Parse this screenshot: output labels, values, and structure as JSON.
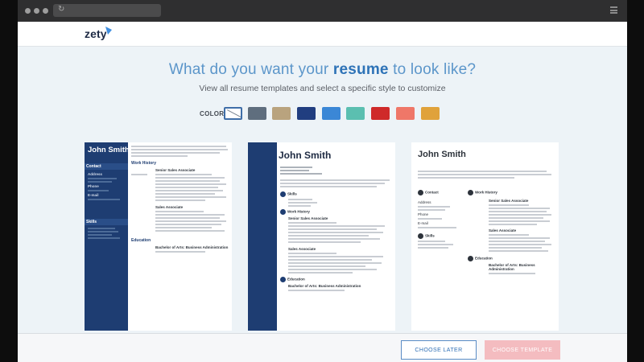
{
  "header": {
    "logo": "zety"
  },
  "hero": {
    "headline_pre": "What do you want your ",
    "headline_emph": "resume",
    "headline_post": " to look like?",
    "subline": "View all resume templates and select a specific style to customize"
  },
  "colors": {
    "label": "COLOR",
    "swatches": [
      "#ffffff",
      "#5f6e7e",
      "#b9a37e",
      "#213e80",
      "#3b87d6",
      "#5bbfb0",
      "#cf2a2a",
      "#ef7768",
      "#e0a23b"
    ],
    "selected_index": 0
  },
  "templates": [
    {
      "name": "John Smith",
      "sections": [
        "Contact",
        "Skills",
        "Work History",
        "Education"
      ],
      "contact_labels": [
        "Address",
        "Phone",
        "E-mail"
      ],
      "jobs": [
        "Senior Sales Associate",
        "Sales Associate"
      ],
      "degree": "Bachelor of Arts: Business Administration"
    },
    {
      "name": "John Smith",
      "sections": [
        "Skills",
        "Work History",
        "Education"
      ],
      "jobs": [
        "Senior Sales Associate",
        "Sales Associate"
      ],
      "degree": "Bachelor of Arts: Business Administration"
    },
    {
      "name": "John Smith",
      "sections": [
        "Contact",
        "Work History",
        "Skills",
        "Education"
      ],
      "contact_labels": [
        "Address",
        "Phone",
        "E-mail"
      ],
      "jobs": [
        "Senior Sales Associate",
        "Sales Associate"
      ],
      "degree": "Bachelor of Arts: Business Administration"
    }
  ],
  "footer": {
    "later_label": "CHOOSE LATER",
    "choose_label": "CHOOSE TEMPLATE"
  }
}
